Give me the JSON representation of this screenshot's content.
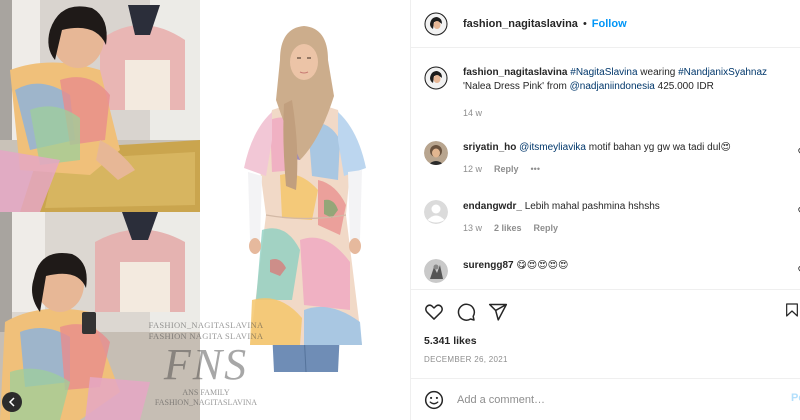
{
  "post": {
    "username": "fashion_nagitaslavina",
    "follow_label": "Follow",
    "header_separator": "•"
  },
  "caption": {
    "username": "fashion_nagitaslavina",
    "hashtag_1": "#NagitaSlavina",
    "text_1": " wearing ",
    "hashtag_2": "#NandjanixSyahnaz",
    "text_2": "'Nalea Dress Pink' from ",
    "mention": "@nadjaniindonesia",
    "text_3": " 425.000 IDR",
    "time": "14 w"
  },
  "comments": [
    {
      "username": "sriyatin_ho",
      "mention": "@itsmeyliavika",
      "text": " motif bahan yg gw wa tadi dul",
      "emoji": "😍",
      "time": "12 w",
      "reply_label": "Reply",
      "more_label": "•••"
    },
    {
      "username": "endangwdr_",
      "text": "Lebih mahal pashmina hshshs",
      "time": "13 w",
      "likes": "2 likes",
      "reply_label": "Reply"
    },
    {
      "username": "surengg87",
      "emojis": "😋😍😍😍😍"
    }
  ],
  "engagement": {
    "likes": "5.341 likes",
    "date": "DECEMBER 26, 2021"
  },
  "composer": {
    "placeholder": "Add a comment…",
    "post_label": "Post"
  },
  "watermark": {
    "line_1": "FASHION_NAGITASLAVINA",
    "line_2": "FASHION NAGITA SLAVINA",
    "monogram": "FNS",
    "line_3": "ANS FAMILY",
    "line_4": "FASHION_NAGITASLAVINA"
  },
  "icons": [
    "heart-icon",
    "comment-icon",
    "share-icon",
    "bookmark-icon",
    "emoji-icon",
    "chevron-left-icon"
  ],
  "colors": {
    "follow_blue": "#0095f6",
    "link_blue": "#00376b",
    "muted": "#8e8e8e",
    "post_disabled": "#b2dffc"
  }
}
